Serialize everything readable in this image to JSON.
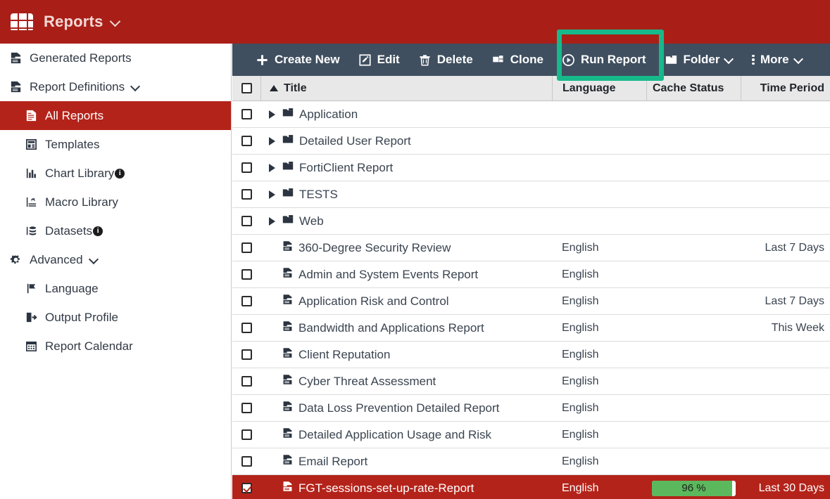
{
  "header": {
    "logo_icon": "app-grid-logo",
    "title": "Reports",
    "chevron_icon": "chevron-down-icon",
    "background": "#a91f17"
  },
  "sidebar": {
    "items": [
      {
        "label": "Generated Reports",
        "icon": "report-icon",
        "indent": false,
        "selected": false,
        "caret": false,
        "info": false
      },
      {
        "label": "Report Definitions",
        "icon": "report-definitions-icon",
        "indent": false,
        "selected": false,
        "caret": true,
        "info": false
      },
      {
        "label": "All Reports",
        "icon": "all-reports-icon",
        "indent": true,
        "selected": true,
        "caret": false,
        "info": false
      },
      {
        "label": "Templates",
        "icon": "templates-icon",
        "indent": true,
        "selected": false,
        "caret": false,
        "info": false
      },
      {
        "label": "Chart Library",
        "icon": "chart-library-icon",
        "indent": true,
        "selected": false,
        "caret": false,
        "info": true
      },
      {
        "label": "Macro Library",
        "icon": "macro-library-icon",
        "indent": true,
        "selected": false,
        "caret": false,
        "info": false
      },
      {
        "label": "Datasets",
        "icon": "datasets-icon",
        "indent": true,
        "selected": false,
        "caret": false,
        "info": true
      },
      {
        "label": "Advanced",
        "icon": "gear-icon",
        "indent": false,
        "selected": false,
        "caret": true,
        "info": false
      },
      {
        "label": "Language",
        "icon": "flag-icon",
        "indent": true,
        "selected": false,
        "caret": false,
        "info": false
      },
      {
        "label": "Output Profile",
        "icon": "output-profile-icon",
        "indent": true,
        "selected": false,
        "caret": false,
        "info": false
      },
      {
        "label": "Report Calendar",
        "icon": "calendar-icon",
        "indent": true,
        "selected": false,
        "caret": false,
        "info": false
      }
    ],
    "selected_color": "#b4231a"
  },
  "toolbar": {
    "background": "#3f4f5f",
    "buttons": [
      {
        "label": "Create New",
        "icon": "plus-icon",
        "chevron": false
      },
      {
        "label": "Edit",
        "icon": "edit-pencil-icon",
        "chevron": false
      },
      {
        "label": "Delete",
        "icon": "trash-icon",
        "chevron": false
      },
      {
        "label": "Clone",
        "icon": "clone-icon",
        "chevron": false
      },
      {
        "label": "Run Report",
        "icon": "play-circle-icon",
        "chevron": false
      },
      {
        "label": "Folder",
        "icon": "folder-icon",
        "chevron": true
      },
      {
        "label": "More",
        "icon": "vertical-dots-icon",
        "chevron": true
      }
    ]
  },
  "highlight": {
    "target": "Run Report",
    "color": "#17b98b"
  },
  "table": {
    "columns": [
      {
        "label": "",
        "key": "checkbox"
      },
      {
        "label": "Title",
        "key": "title",
        "sorted": "asc"
      },
      {
        "label": "Language",
        "key": "language"
      },
      {
        "label": "Cache Status",
        "key": "cache_status"
      },
      {
        "label": "Time Period",
        "key": "time_period"
      }
    ],
    "rows": [
      {
        "title": "Application",
        "type": "folder",
        "language": "",
        "cache": null,
        "time_period": "",
        "checked": false,
        "selected": false
      },
      {
        "title": "Detailed User Report",
        "type": "folder",
        "language": "",
        "cache": null,
        "time_period": "",
        "checked": false,
        "selected": false
      },
      {
        "title": "FortiClient Report",
        "type": "folder",
        "language": "",
        "cache": null,
        "time_period": "",
        "checked": false,
        "selected": false
      },
      {
        "title": "TESTS",
        "type": "folder",
        "language": "",
        "cache": null,
        "time_period": "",
        "checked": false,
        "selected": false
      },
      {
        "title": "Web",
        "type": "folder",
        "language": "",
        "cache": null,
        "time_period": "",
        "checked": false,
        "selected": false
      },
      {
        "title": "360-Degree Security Review",
        "type": "report",
        "language": "English",
        "cache": null,
        "time_period": "Last 7 Days",
        "checked": false,
        "selected": false
      },
      {
        "title": "Admin and System Events Report",
        "type": "report",
        "language": "English",
        "cache": null,
        "time_period": "",
        "checked": false,
        "selected": false
      },
      {
        "title": "Application Risk and Control",
        "type": "report",
        "language": "English",
        "cache": null,
        "time_period": "Last 7 Days",
        "checked": false,
        "selected": false
      },
      {
        "title": "Bandwidth and Applications Report",
        "type": "report",
        "language": "English",
        "cache": null,
        "time_period": "This Week",
        "checked": false,
        "selected": false
      },
      {
        "title": "Client Reputation",
        "type": "report",
        "language": "English",
        "cache": null,
        "time_period": "",
        "checked": false,
        "selected": false
      },
      {
        "title": "Cyber Threat Assessment",
        "type": "report",
        "language": "English",
        "cache": null,
        "time_period": "",
        "checked": false,
        "selected": false
      },
      {
        "title": "Data Loss Prevention Detailed Report",
        "type": "report",
        "language": "English",
        "cache": null,
        "time_period": "",
        "checked": false,
        "selected": false
      },
      {
        "title": "Detailed Application Usage and Risk",
        "type": "report",
        "language": "English",
        "cache": null,
        "time_period": "",
        "checked": false,
        "selected": false
      },
      {
        "title": "Email Report",
        "type": "report",
        "language": "English",
        "cache": null,
        "time_period": "",
        "checked": false,
        "selected": false
      },
      {
        "title": "FGT-sessions-set-up-rate-Report",
        "type": "report",
        "language": "English",
        "cache": {
          "percent": 96,
          "label": "96 %",
          "color": "#5cb85c"
        },
        "time_period": "Last 30 Days",
        "checked": true,
        "selected": true
      }
    ]
  }
}
